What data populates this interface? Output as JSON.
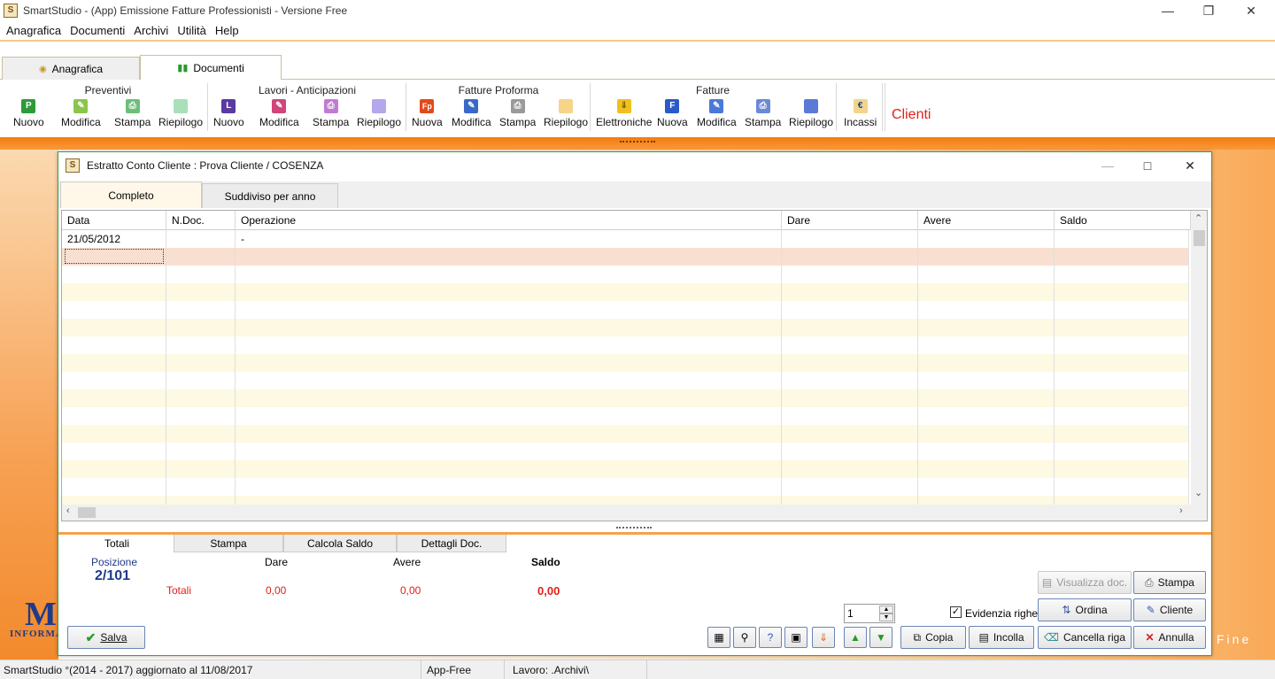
{
  "app": {
    "title": "SmartStudio  - (App) Emissione Fatture Professionisti - Versione Free",
    "icon_letter": "S"
  },
  "menu": [
    "Anagrafica",
    "Documenti",
    "Archivi",
    "Utilità",
    "Help"
  ],
  "ribbon_tabs": [
    "Anagrafica",
    "Documenti"
  ],
  "ribbon": {
    "groups": [
      "Preventivi",
      "Lavori - Anticipazioni",
      "Fatture Proforma",
      "Fatture"
    ],
    "preventivi": [
      "Nuovo",
      "Modifica",
      "Stampa",
      "Riepilogo"
    ],
    "lavori": [
      "Nuovo",
      "Modifica",
      "Stampa",
      "Riepilogo"
    ],
    "proforma": [
      "Nuova",
      "Modifica",
      "Stampa",
      "Riepilogo"
    ],
    "fatture": [
      "Elettroniche",
      "Nuova",
      "Modifica",
      "Stampa",
      "Riepilogo"
    ],
    "incassi": "Incassi",
    "clienti": "Clienti"
  },
  "window": {
    "title": "Estratto Conto Cliente : Prova Cliente  / COSENZA",
    "tabs": [
      "Completo",
      "Suddiviso per anno"
    ]
  },
  "grid": {
    "columns": [
      "Data",
      "N.Doc.",
      "Operazione",
      "Dare",
      "Avere",
      "Saldo"
    ],
    "rows": [
      {
        "data": "21/05/2012",
        "ndoc": "",
        "operazione": "-",
        "dare": "",
        "avere": "",
        "saldo": ""
      }
    ]
  },
  "bottom_tabs": [
    "Totali",
    "Stampa",
    "Calcola Saldo",
    "Dettagli Doc."
  ],
  "totali": {
    "posizione_label": "Posizione",
    "posizione_value": "2/101",
    "dare_label": "Dare",
    "avere_label": "Avere",
    "saldo_label": "Saldo",
    "totali_label": "Totali",
    "dare": "0,00",
    "avere": "0,00",
    "saldo": "0,00"
  },
  "controls": {
    "spin_value": "1",
    "evidenzia": "Evidenzia righe",
    "visualizza": "Visualizza doc.",
    "stampa": "Stampa",
    "ordina": "Ordina",
    "cliente": "Cliente",
    "copia": "Copia",
    "incolla": "Incolla",
    "cancella": "Cancella riga",
    "annulla": "Annulla",
    "salva": "Salva"
  },
  "background": {
    "logo_text": "INFORMA",
    "fine": "Fine"
  },
  "status": {
    "copyright": "SmartStudio °(2014 - 2017)  aggiornato al 11/08/2017",
    "edition": "App-Free",
    "lavoro": "Lavoro: .Archivi\\"
  },
  "colors": {
    "accent_orange": "#f27a10",
    "totals_red": "#e0201a",
    "posizione_blue": "#1f3a8a",
    "selected_row": "#f9dfd0",
    "odd_row": "#fdf9e2"
  }
}
